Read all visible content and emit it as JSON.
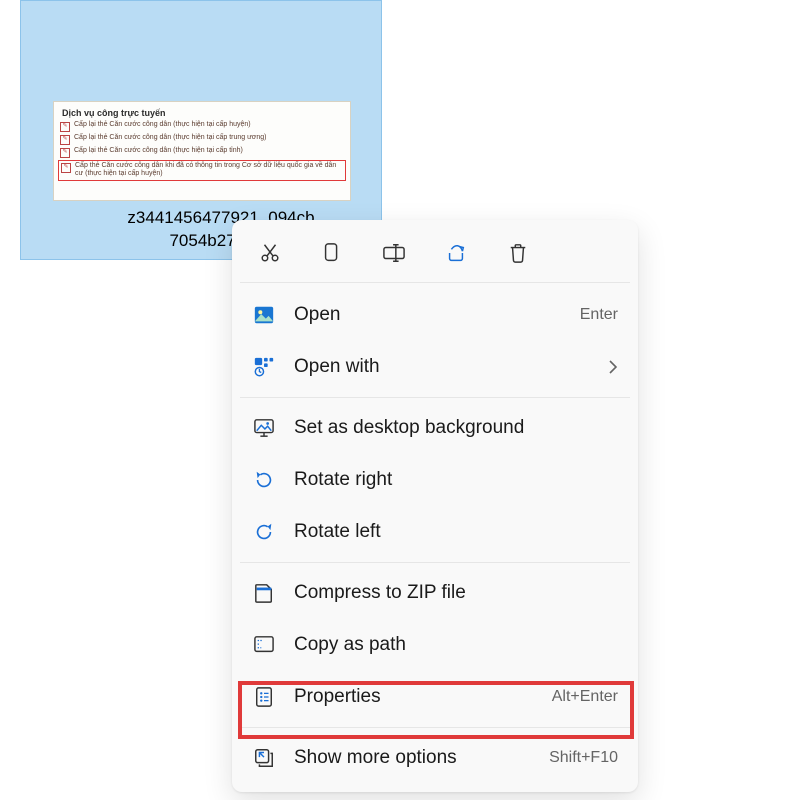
{
  "file": {
    "name_line1": "z3441456477921_094cb",
    "name_line2": "7054b27a29c"
  },
  "thumbnail": {
    "title": "Dịch vụ công trực tuyến",
    "rows": [
      "Cấp lại thẻ Căn cước công dân (thực hiện tại cấp huyện)",
      "Cấp lại thẻ Căn cước công dân (thực hiện tại cấp trung ương)",
      "Cấp lại thẻ Căn cước công dân (thực hiện tại cấp tỉnh)",
      "Cấp thẻ Căn cước công dân khi đã có thông tin trong Cơ sở dữ liệu quốc gia về dân cư (thực hiện tại cấp huyện)"
    ]
  },
  "topbar": {
    "cut": "Cut",
    "copy": "Copy",
    "rename": "Rename",
    "share": "Share",
    "delete": "Delete"
  },
  "menu": {
    "open": "Open",
    "open_accel": "Enter",
    "open_with": "Open with",
    "set_bg": "Set as desktop background",
    "rotate_right": "Rotate right",
    "rotate_left": "Rotate left",
    "zip": "Compress to ZIP file",
    "copy_path": "Copy as path",
    "properties": "Properties",
    "properties_accel": "Alt+Enter",
    "more": "Show more options",
    "more_accel": "Shift+F10"
  }
}
